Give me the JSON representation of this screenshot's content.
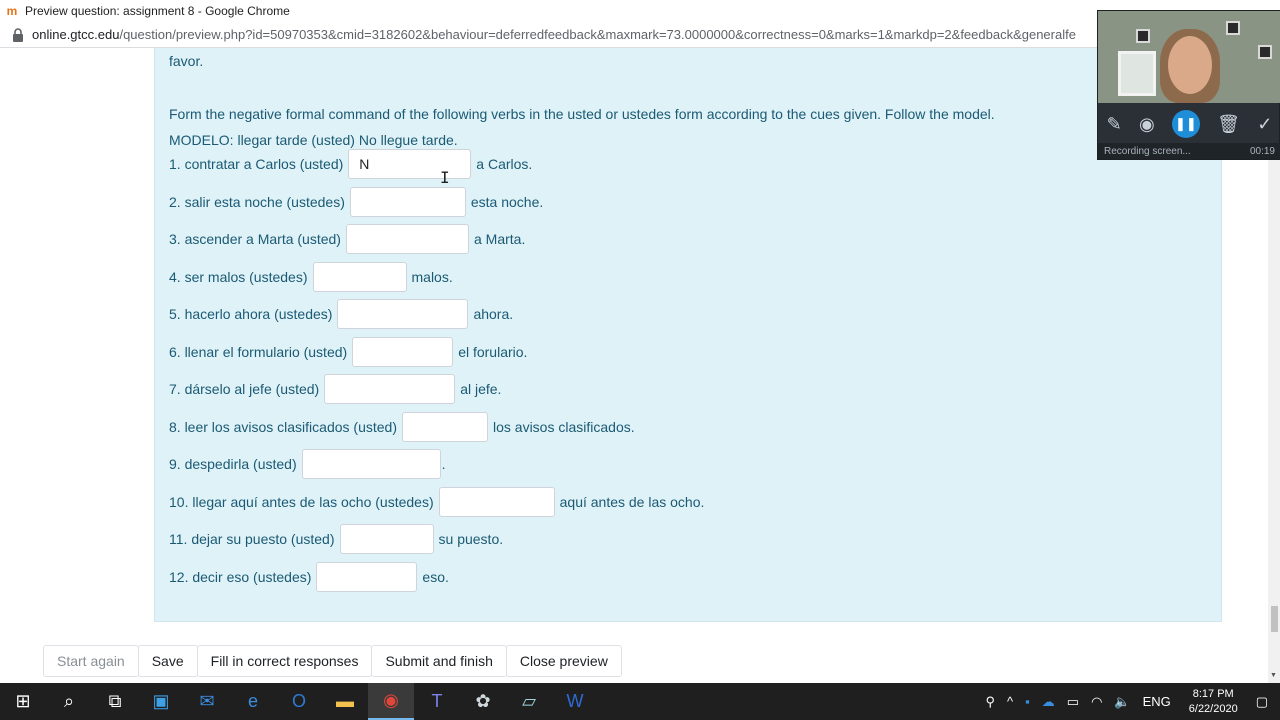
{
  "browser": {
    "title": "Preview question: assignment 8 - Google Chrome",
    "url_host": "online.gtcc.edu",
    "url_path": "/question/preview.php?id=50970353&cmid=3182602&behaviour=deferredfeedback&maxmark=73.0000000&correctness=0&marks=1&markdp=2&feedback&generalfe"
  },
  "question": {
    "prev_text": "favor.",
    "instructions": "Form the negative formal command of the following verbs in the usted or ustedes form according to the cues given. Follow the model.",
    "model": "MODELO: llegar tarde (usted) No llegue tarde.",
    "items": [
      {
        "prompt": "1. contratar a Carlos (usted)",
        "value": "N",
        "suffix": "a Carlos."
      },
      {
        "prompt": "2. salir esta noche (ustedes)",
        "value": "",
        "suffix": "esta noche."
      },
      {
        "prompt": "3. ascender a Marta (usted)",
        "value": "",
        "suffix": "a Marta."
      },
      {
        "prompt": "4. ser malos (ustedes)",
        "value": "",
        "suffix": "malos."
      },
      {
        "prompt": "5. hacerlo ahora (ustedes)",
        "value": "",
        "suffix": "ahora."
      },
      {
        "prompt": "6. llenar el formulario (usted)",
        "value": "",
        "suffix": "el forulario."
      },
      {
        "prompt": "7. dárselo al jefe (usted)",
        "value": "",
        "suffix": "al jefe."
      },
      {
        "prompt": "8. leer los avisos clasificados (usted)",
        "value": "",
        "suffix": "los avisos clasificados."
      },
      {
        "prompt": "9. despedirla (usted)",
        "value": "",
        "suffix": "."
      },
      {
        "prompt": "10. llegar aquí antes de las ocho (ustedes)",
        "value": "",
        "suffix": "aquí antes de las ocho."
      },
      {
        "prompt": "11. dejar su puesto (usted)",
        "value": "",
        "suffix": "su puesto."
      },
      {
        "prompt": "12. decir eso (ustedes)",
        "value": "",
        "suffix": "eso."
      }
    ]
  },
  "buttons": {
    "start_again": "Start again",
    "save": "Save",
    "fill_correct": "Fill in correct responses",
    "submit_finish": "Submit and finish",
    "close_preview": "Close preview"
  },
  "recorder": {
    "status": "Recording screen...",
    "time": "00:19"
  },
  "taskbar": {
    "lang": "ENG",
    "time": "8:17 PM",
    "date": "6/22/2020"
  }
}
